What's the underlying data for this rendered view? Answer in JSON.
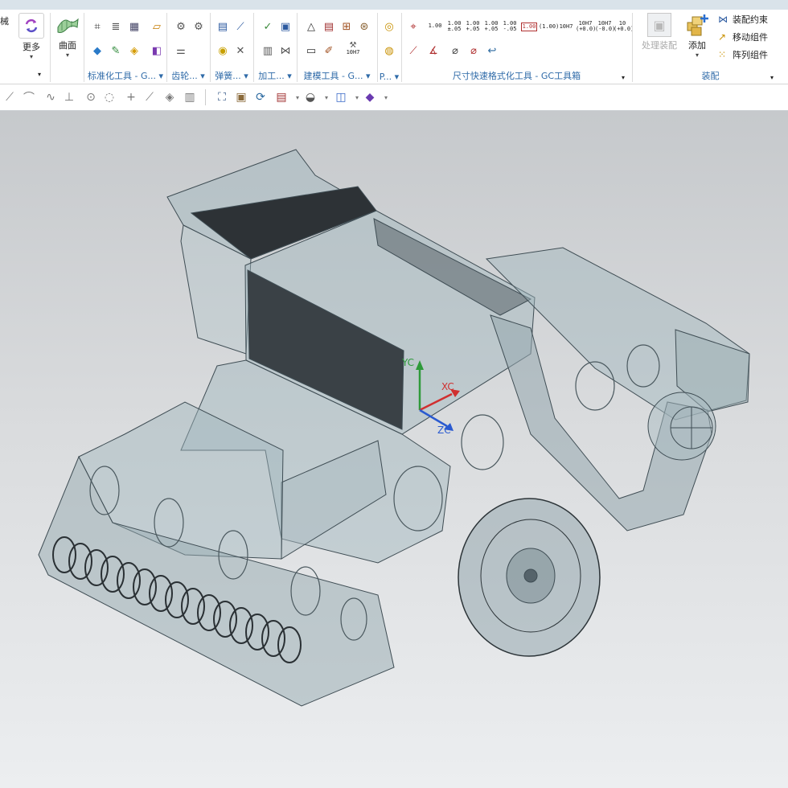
{
  "ribbon": {
    "left_cut_text": "械",
    "more_label": "更多",
    "surface_label": "曲面",
    "groups": {
      "standard": "标准化工具 - G...",
      "gear": "齿轮...",
      "spring": "弹簧...",
      "machining": "加工...",
      "modeling": "建模工具 - G...",
      "p": "P...",
      "dimension": "尺寸快速格式化工具 - GC工具箱",
      "assembly": "装配"
    },
    "dimension_tags": {
      "plain": "1.00",
      "tol_a": "1.00\n±.05",
      "tol_b": "1.00\n+.05",
      "tol_c": "1.00\n+.05",
      "tol_d": "1.00\n-.05",
      "box": "1.00",
      "paren": "(1.00)",
      "fit": "10H7",
      "fit_a": "10H7\n(+0.0)",
      "fit_b": "10H7\n(-0.0)",
      "fit_c": "10\n(+0.0)",
      "fit_small": "10H7"
    },
    "assembly": {
      "process_label": "处理装配",
      "add_label": "添加",
      "constraint_label": "装配约束",
      "move_label": "移动组件",
      "array_label": "阵列组件"
    }
  },
  "axis_labels": {
    "xc": "XC",
    "yc": "YC",
    "zc": "ZC"
  },
  "colors": {
    "accent_blue": "#2e6aa8",
    "body_glass": "#b9c6ca",
    "edge": "#3f4d54"
  }
}
